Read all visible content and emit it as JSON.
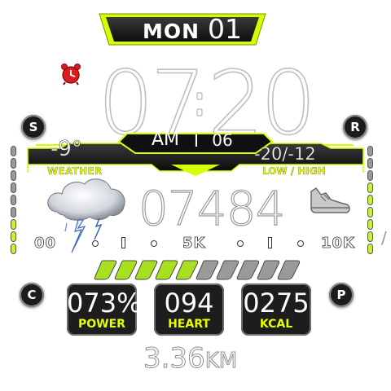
{
  "date": {
    "day": "MON",
    "number": "01"
  },
  "time": {
    "hour": "07",
    "minute": "20",
    "ampm": "AM",
    "separator": "I",
    "seconds": "06"
  },
  "weather": {
    "temperature": "-9°",
    "label": "WEATHER",
    "low_high": "-20/-12",
    "low_high_label": "LOW / HIGH",
    "icon": "storm-cloud-icon"
  },
  "corner_buttons": {
    "top_left": "S",
    "top_right": "R",
    "bottom_left": "C",
    "bottom_right": "P"
  },
  "steps": {
    "count": "07484",
    "icon": "shoe-icon",
    "goal_fraction": 0.53
  },
  "scale": {
    "start": "00",
    "mid": "5K",
    "end": "10K",
    "separator": "/"
  },
  "stats": {
    "power": {
      "value": "073%",
      "label": "POWER"
    },
    "heart": {
      "value": "094",
      "label": "HEART"
    },
    "kcal": {
      "value": "0275",
      "label": "KCAL"
    }
  },
  "distance": {
    "value": "3.36",
    "unit": "KM"
  },
  "colors": {
    "accent": "#d4ff00",
    "plate": "#1c1c1c",
    "segment_on": "#a8e020",
    "segment_off": "#9a9a9a"
  }
}
